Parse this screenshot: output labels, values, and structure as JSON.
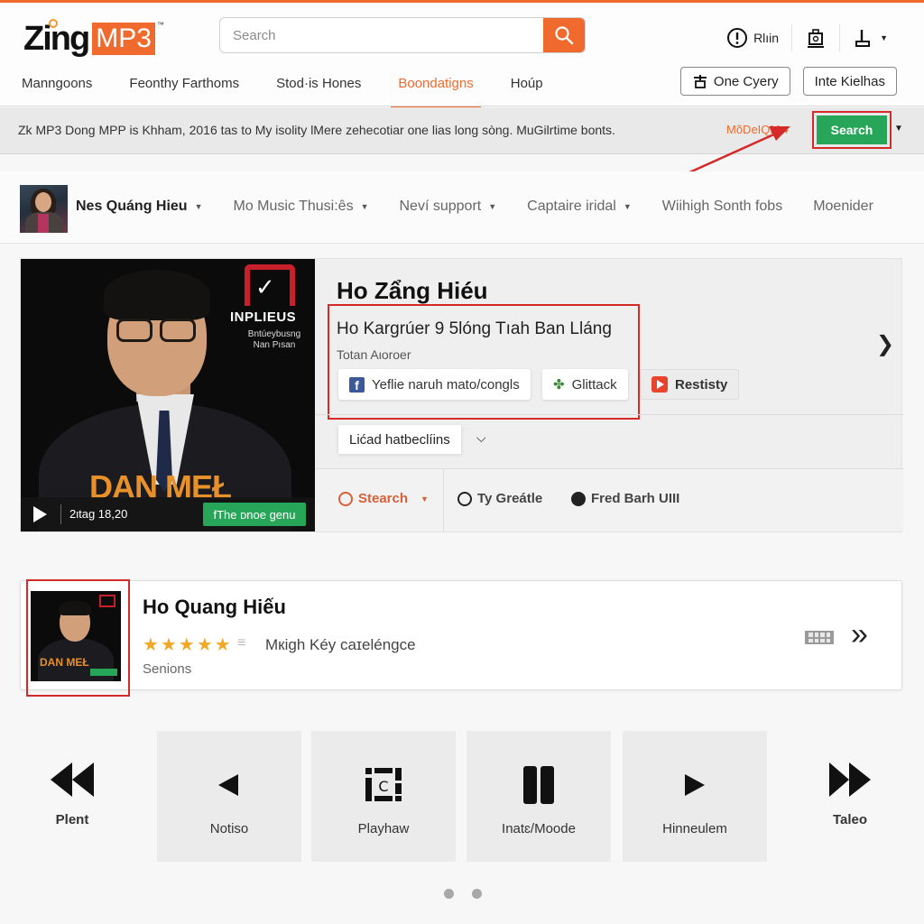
{
  "brand": {
    "logo_word": "Zing",
    "logo_badge": "MP3",
    "logo_tm": "™",
    "accent_color": "#ef6a2c",
    "green_color": "#27a558",
    "highlight_color": "#d42a2a"
  },
  "header": {
    "search": {
      "placeholder": "Search",
      "button_icon": "search-icon"
    },
    "actions": [
      {
        "icon": "alert-circle-icon",
        "label": "Rlıin"
      },
      {
        "icon": "bag-icon",
        "label": ""
      },
      {
        "icon": "upload-icon",
        "label": ""
      }
    ]
  },
  "nav": {
    "items": [
      {
        "label": "Manngoons",
        "active": false
      },
      {
        "label": "Feonthy Farthoms",
        "active": false
      },
      {
        "label": "Stod·is Hones",
        "active": false
      },
      {
        "label": "Boondatigns",
        "active": true
      },
      {
        "label": "Hoúp",
        "active": false
      }
    ],
    "buttons": [
      {
        "icon": "filter-icon",
        "label": "One Cyery"
      },
      {
        "label": "Inte Kielhas"
      }
    ]
  },
  "info_bar": {
    "text": "Zk MP3 Dong MPP is Khham, 2016 tas to My isolity lMere zehecotiar one lias long sòng. MuGilrtime bonts.",
    "mode_label": "MõDeIQM",
    "search_button": "Search"
  },
  "artist_strip": {
    "items": [
      {
        "label": "Nes Quáng Hieu",
        "dropdown": true,
        "bold": true
      },
      {
        "label": "Mo Music Thusi:ês",
        "dropdown": true
      },
      {
        "label": "Neví support",
        "dropdown": true
      },
      {
        "label": "Captaire iridal",
        "dropdown": true
      },
      {
        "label": "Wiihigh Sonth fobs",
        "dropdown": false
      },
      {
        "label": "Moenider",
        "dropdown": false
      }
    ]
  },
  "hero": {
    "cover": {
      "brand": "INPLIEUS",
      "sub_line1": "Bntúeybusng",
      "sub_line2": "Nan Pısan",
      "title": "DAN MEŁ",
      "time": "2ιtag 18,20",
      "genre_button": "fThe ᴅnoe genu"
    },
    "title": "Ho Zẩng Hiéu",
    "song": "Ho Kargrúer 9 5lóng Tıah Ban Lláng",
    "author": "Totan Aιoroer",
    "share_buttons": [
      {
        "icon": "facebook-icon",
        "label": "Yeflie naruh mato/congls"
      },
      {
        "icon": "clover-icon",
        "label": "Glittack"
      },
      {
        "icon": "youtube-icon",
        "label": "Restisty"
      }
    ],
    "load_button": "Lićad hatbeclíins",
    "bottom": [
      {
        "icon": "bulb-icon",
        "label": "Stearch",
        "dropdown": true
      },
      {
        "icon": "circle-outline-icon",
        "label": "Ty Greátle"
      },
      {
        "icon": "circle-filled-icon",
        "label": "Fred Barh UIII"
      }
    ]
  },
  "result": {
    "title": "Ho Quang Hiếu",
    "rating": 5,
    "rating_max": 5,
    "description": "Mкigh Kéy caɪeléngce",
    "subtitle": "Senions"
  },
  "controls": [
    {
      "icon": "rewind-icon",
      "label": "Plent"
    },
    {
      "icon": "previous-icon",
      "label": "Notiso"
    },
    {
      "icon": "playlist-icon",
      "label": "Playhaw"
    },
    {
      "icon": "pause-icon",
      "label": "Inatɛ/Moode"
    },
    {
      "icon": "play-icon",
      "label": "Hinneulem"
    },
    {
      "icon": "fast-forward-icon",
      "label": "Taleo"
    }
  ],
  "pagination": {
    "pages": 2
  }
}
